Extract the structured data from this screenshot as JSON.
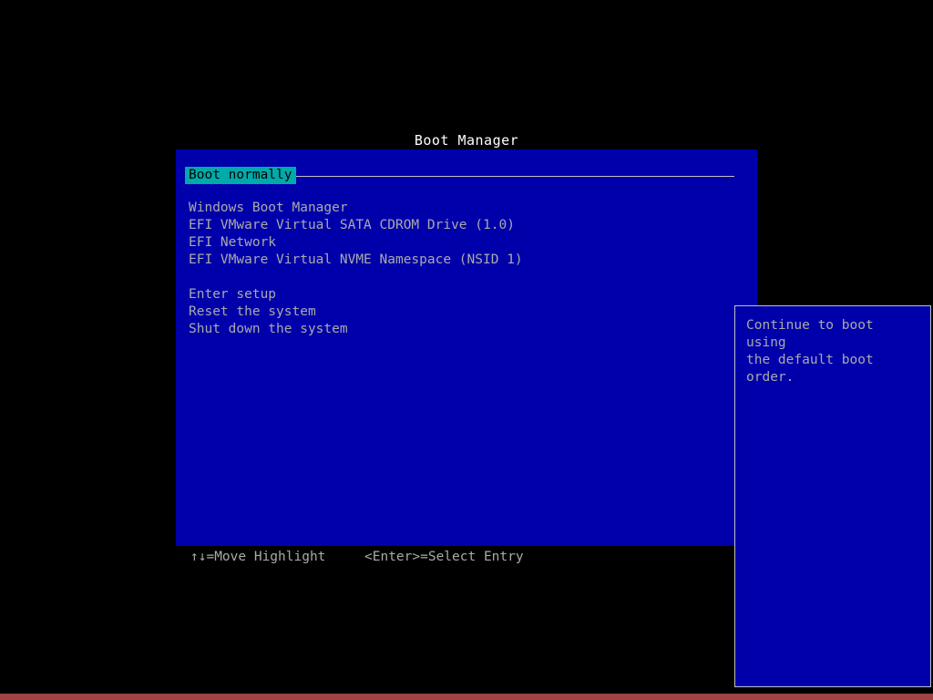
{
  "screen": {
    "title": "Boot Manager",
    "background_color": "#000000",
    "panel_color": "#0000aa",
    "text_color": "#aaaaaa",
    "highlight_bg_color": "#00aaaa",
    "highlight_fg_color": "#000000",
    "border_color": "#c0c0c0",
    "title_color": "#ffffff",
    "bottom_band_color": "#9e4444"
  },
  "menu": {
    "selected_index": 0,
    "items": [
      {
        "label": "Boot normally",
        "selected": true,
        "spacer": false
      },
      {
        "label": "",
        "selected": false,
        "spacer": true
      },
      {
        "label": "Windows Boot Manager",
        "selected": false,
        "spacer": false
      },
      {
        "label": "EFI VMware Virtual SATA CDROM Drive (1.0)",
        "selected": false,
        "spacer": false
      },
      {
        "label": "EFI Network",
        "selected": false,
        "spacer": false
      },
      {
        "label": "EFI VMware Virtual NVME Namespace (NSID 1)",
        "selected": false,
        "spacer": false
      },
      {
        "label": "",
        "selected": false,
        "spacer": true
      },
      {
        "label": "Enter setup",
        "selected": false,
        "spacer": false
      },
      {
        "label": "Reset the system",
        "selected": false,
        "spacer": false
      },
      {
        "label": "Shut down the system",
        "selected": false,
        "spacer": false
      }
    ]
  },
  "description": {
    "text": "Continue to boot using\nthe default boot order."
  },
  "footer": {
    "move_hint": "↑↓=Move Highlight",
    "select_hint": "<Enter>=Select Entry"
  }
}
